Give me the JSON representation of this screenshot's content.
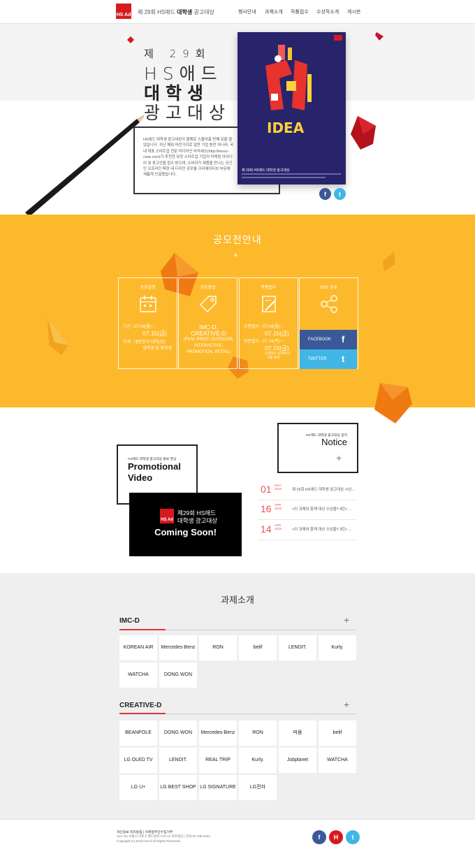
{
  "header": {
    "logo_text": "HS Ad",
    "title_prefix": "제 29회 HS애드",
    "title_bold": "대학생",
    "title_suffix": "광고대상",
    "nav": [
      "행사안내",
      "과제소개",
      "작품접수",
      "수상작소개",
      "게시판"
    ]
  },
  "hero": {
    "line1": "제 29회",
    "line2": "HS애드",
    "line3": "대학생",
    "line4": "광고대상",
    "intro": "HS애드 대학생 광고대상이 올해로 스물아홉 번째 문을 열었습니다. 지난 해와 마찬가지로 일반 기업 뿐만 아니라, 국내 대표 스타트업 전문 미디어인 비석세스(http://besuc-cess.com)가 추천한 유망 스타트업 기업의 마케팅 아이디어 및 광고안을 접수 받으며, 소비자가 제품을 만나는 공간인 오프라인 매장 내 디자인 공모를 크리에이티브 부문에 새롭게 신설했습니다.",
    "poster_caption": "제 29회 HS애드 대학생 광고대상",
    "poster_idea": "IDEA"
  },
  "contest": {
    "title": "공모전안내",
    "cards": [
      {
        "title": "공모일정",
        "lines": [
          "기간 : 07.04(월) ~",
          "07.15(금)",
          "자격 : 대한민국 대학(원)",
          "재학생 및 휴학생"
        ]
      },
      {
        "title": "공모방법",
        "lines": [
          "IMC-D,",
          "CREATIVE-D",
          "(FILM, PRINT, OUTDOOR,",
          "INTERACTIVE,",
          "PROMOTION, RETAIL)"
        ]
      },
      {
        "title": "작품접수",
        "lines": [
          "우편접수 : 07.04(월) ~",
          "07.15(금)",
          "방문접수 : 07.14(목) ~",
          "07.15(금)",
          "오전9시~오후5시",
          "1층 로비"
        ]
      },
      {
        "title": "SNS 공유",
        "facebook": "FACEBOOK",
        "twitter": "TWITTER"
      }
    ]
  },
  "video": {
    "small": "HS애드 대학생 광고대상 홍보 영상",
    "title_line1": "Promotional",
    "title_line2": "Video",
    "logo": "HS Ad",
    "caption_line1": "제29회 HS애드",
    "caption_line2": "대학생 광고대상",
    "soon": "Coming Soon!"
  },
  "notice": {
    "small": "HS애드 대학생 광고대상 공지",
    "title": "Notice",
    "items": [
      {
        "day": "01",
        "month": "MAY",
        "year": "2016",
        "text": "제 29회 HS애드 대학생 광고대상 시상..."
      },
      {
        "day": "16",
        "month": "APR",
        "year": "2016",
        "text": "<이 과제와 함께 대상 수상을!! 4탄> ..."
      },
      {
        "day": "14",
        "month": "APR",
        "year": "2016",
        "text": "<이 과제와 함께 대상 수상을!! 3탄> ..."
      }
    ]
  },
  "tasks": {
    "title": "과제소개",
    "imc_title": "IMC-D",
    "imc_logos": [
      "KOREAN AIR",
      "Mercedes-Benz",
      "RON",
      "belif",
      "LENDIT.",
      "Kurly.",
      "WATCHA",
      "DONG WON"
    ],
    "creative_title": "CREATIVE-D",
    "creative_logos": [
      "BEANPOLE",
      "DONG WON",
      "Mercedes-Benz",
      "RON",
      "따옴",
      "belif",
      "LG OLED TV",
      "LENDIT.",
      "REAL TRIP",
      "Kurly.",
      "Jobplanet",
      "WATCHA",
      "LG U+",
      "LG BEST SHOP",
      "LG SIGNATURE",
      "LG전자"
    ]
  },
  "footer": {
    "links": "개인정보 처리방침  |  이메일무단수집거부",
    "address": "121-711 서울시 마포구 월드컵로 275 LG 마포빌딩 | 전화 02-705-2334",
    "copyright": "Copyright (c) 2016 HSAd All Rights Reserved."
  },
  "colors": {
    "accent": "#d71920",
    "yellow": "#fdb92c",
    "facebook": "#3b5998",
    "twitter": "#41b6e6",
    "notice_red": "#e8554e"
  }
}
